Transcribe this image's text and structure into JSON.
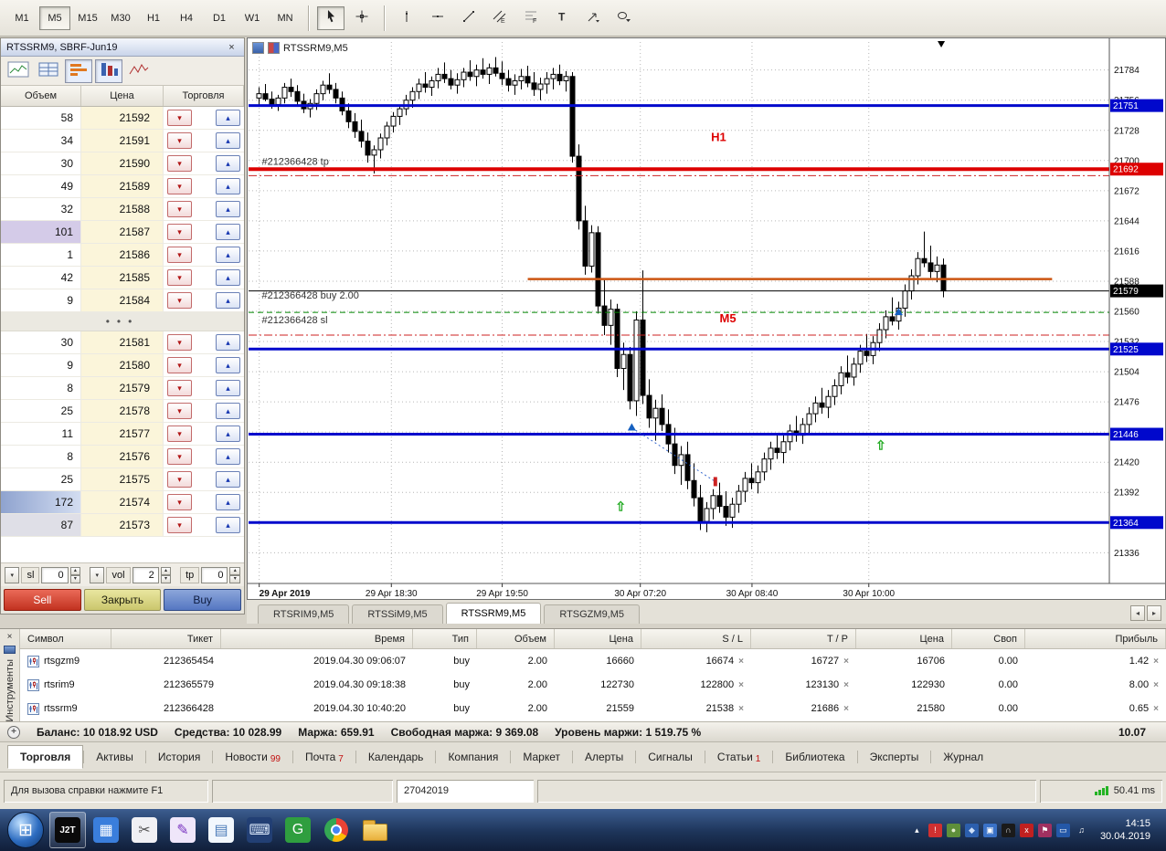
{
  "top_toolbar": {
    "timeframes": [
      "M1",
      "M5",
      "M15",
      "M30",
      "H1",
      "H4",
      "D1",
      "W1",
      "MN"
    ],
    "active_timeframe": "M5",
    "tools": [
      {
        "name": "cursor",
        "active": true
      },
      {
        "name": "crosshair"
      },
      {
        "name": "vertical-line"
      },
      {
        "name": "horizontal-line"
      },
      {
        "name": "trendline"
      },
      {
        "name": "equidistant-channel"
      },
      {
        "name": "fibonacci"
      },
      {
        "name": "text"
      },
      {
        "name": "arrows"
      },
      {
        "name": "objects-dropdown"
      }
    ]
  },
  "dom_panel": {
    "title": "RTSSRM9, SBRF-Jun19",
    "close_glyph": "×",
    "toolbar": [
      {
        "name": "new-chart-icon"
      },
      {
        "name": "market-depth-grid-icon"
      },
      {
        "name": "volume-profile-icon",
        "pressed": true
      },
      {
        "name": "dom-columns-icon",
        "pressed": true
      },
      {
        "name": "tick-chart-icon"
      }
    ],
    "columns": [
      "Объем",
      "Цена",
      "Торговля"
    ],
    "asks": [
      [
        58,
        21592
      ],
      [
        34,
        21591
      ],
      [
        30,
        21590
      ],
      [
        49,
        21589
      ],
      [
        32,
        21588
      ],
      [
        101,
        21587,
        "lav"
      ],
      [
        1,
        21586
      ],
      [
        42,
        21585
      ],
      [
        9,
        21584
      ]
    ],
    "dots": "•••",
    "bids": [
      [
        30,
        21581
      ],
      [
        9,
        21580
      ],
      [
        8,
        21579
      ],
      [
        25,
        21578
      ],
      [
        11,
        21577
      ],
      [
        8,
        21576
      ],
      [
        25,
        21575
      ],
      [
        172,
        21574,
        "blue"
      ],
      [
        87,
        21573,
        "gray"
      ]
    ],
    "controls": {
      "sl_label": "sl",
      "sl": "0",
      "vol_label": "vol",
      "vol": "2",
      "tp_label": "tp",
      "tp": "0"
    },
    "buttons": {
      "sell": "Sell",
      "close": "Закрыть",
      "buy": "Buy"
    }
  },
  "chart_data": {
    "type": "candlestick",
    "symbol_label": "RTSSRM9,M5",
    "ylim": [
      21310,
      21810
    ],
    "yticks": [
      21784,
      21756,
      21728,
      21700,
      21672,
      21644,
      21616,
      21588,
      21560,
      21532,
      21504,
      21476,
      21448,
      21420,
      21392,
      21364,
      21336
    ],
    "xticks": [
      {
        "text": "29 Apr 2019",
        "frac": 0.005,
        "bold": true,
        "anchor": "start"
      },
      {
        "text": "29 Apr 18:30",
        "frac": 0.16
      },
      {
        "text": "29 Apr 19:50",
        "frac": 0.29
      },
      {
        "text": "30 Apr 07:20",
        "frac": 0.452
      },
      {
        "text": "30 Apr 08:40",
        "frac": 0.583
      },
      {
        "text": "30 Apr 10:00",
        "frac": 0.72
      }
    ],
    "candles": [
      [
        21758,
        21768,
        21750,
        21762
      ],
      [
        21762,
        21771,
        21755,
        21757
      ],
      [
        21757,
        21764,
        21748,
        21752
      ],
      [
        21752,
        21761,
        21746,
        21758
      ],
      [
        21758,
        21772,
        21753,
        21768
      ],
      [
        21768,
        21776,
        21759,
        21764
      ],
      [
        21764,
        21770,
        21752,
        21755
      ],
      [
        21755,
        21762,
        21744,
        21748
      ],
      [
        21748,
        21757,
        21740,
        21753
      ],
      [
        21753,
        21766,
        21747,
        21762
      ],
      [
        21762,
        21774,
        21756,
        21770
      ],
      [
        21770,
        21781,
        21762,
        21766
      ],
      [
        21766,
        21772,
        21753,
        21758
      ],
      [
        21758,
        21764,
        21742,
        21746
      ],
      [
        21746,
        21753,
        21730,
        21736
      ],
      [
        21736,
        21744,
        21721,
        21727
      ],
      [
        21727,
        21738,
        21712,
        21718
      ],
      [
        21718,
        21726,
        21698,
        21705
      ],
      [
        21705,
        21714,
        21688,
        21710
      ],
      [
        21710,
        21725,
        21702,
        21721
      ],
      [
        21721,
        21736,
        21714,
        21732
      ],
      [
        21732,
        21745,
        21726,
        21741
      ],
      [
        21741,
        21752,
        21733,
        21748
      ],
      [
        21748,
        21761,
        21742,
        21756
      ],
      [
        21756,
        21768,
        21749,
        21764
      ],
      [
        21764,
        21776,
        21757,
        21771
      ],
      [
        21771,
        21782,
        21763,
        21768
      ],
      [
        21768,
        21778,
        21760,
        21774
      ],
      [
        21774,
        21786,
        21767,
        21780
      ],
      [
        21780,
        21791,
        21772,
        21776
      ],
      [
        21776,
        21784,
        21766,
        21770
      ],
      [
        21770,
        21781,
        21762,
        21775
      ],
      [
        21775,
        21786,
        21768,
        21782
      ],
      [
        21782,
        21793,
        21774,
        21778
      ],
      [
        21778,
        21789,
        21769,
        21784
      ],
      [
        21784,
        21795,
        21776,
        21780
      ],
      [
        21780,
        21790,
        21771,
        21786
      ],
      [
        21786,
        21796,
        21778,
        21781
      ],
      [
        21781,
        21792,
        21770,
        21776
      ],
      [
        21776,
        21784,
        21764,
        21770
      ],
      [
        21770,
        21780,
        21761,
        21774
      ],
      [
        21774,
        21785,
        21766,
        21778
      ],
      [
        21778,
        21788,
        21768,
        21772
      ],
      [
        21772,
        21782,
        21760,
        21766
      ],
      [
        21766,
        21777,
        21756,
        21771
      ],
      [
        21771,
        21782,
        21762,
        21776
      ],
      [
        21776,
        21786,
        21766,
        21780
      ],
      [
        21780,
        21789,
        21770,
        21774
      ],
      [
        21774,
        21783,
        21764,
        21778
      ],
      [
        21778,
        21782,
        21698,
        21704
      ],
      [
        21704,
        21715,
        21636,
        21644
      ],
      [
        21644,
        21658,
        21594,
        21602
      ],
      [
        21602,
        21640,
        21596,
        21633
      ],
      [
        21633,
        21639,
        21558,
        21565
      ],
      [
        21565,
        21589,
        21538,
        21547
      ],
      [
        21547,
        21571,
        21529,
        21562
      ],
      [
        21562,
        21567,
        21499,
        21507
      ],
      [
        21507,
        21531,
        21487,
        21520
      ],
      [
        21520,
        21527,
        21469,
        21477
      ],
      [
        21477,
        21560,
        21463,
        21552
      ],
      [
        21552,
        21598,
        21474,
        21482
      ],
      [
        21482,
        21497,
        21452,
        21461
      ],
      [
        21461,
        21478,
        21440,
        21470
      ],
      [
        21470,
        21483,
        21449,
        21455
      ],
      [
        21455,
        21469,
        21429,
        21437
      ],
      [
        21437,
        21452,
        21409,
        21417
      ],
      [
        21417,
        21435,
        21399,
        21427
      ],
      [
        21427,
        21439,
        21395,
        21403
      ],
      [
        21403,
        21419,
        21379,
        21387
      ],
      [
        21387,
        21399,
        21357,
        21365
      ],
      [
        21365,
        21383,
        21355,
        21377
      ],
      [
        21377,
        21395,
        21367,
        21389
      ],
      [
        21389,
        21401,
        21373,
        21379
      ],
      [
        21379,
        21393,
        21361,
        21369
      ],
      [
        21369,
        21387,
        21359,
        21381
      ],
      [
        21381,
        21399,
        21373,
        21393
      ],
      [
        21393,
        21411,
        21383,
        21405
      ],
      [
        21405,
        21419,
        21395,
        21401
      ],
      [
        21401,
        21417,
        21391,
        21411
      ],
      [
        21411,
        21429,
        21403,
        21423
      ],
      [
        21423,
        21439,
        21413,
        21433
      ],
      [
        21433,
        21447,
        21423,
        21429
      ],
      [
        21429,
        21445,
        21419,
        21439
      ],
      [
        21439,
        21455,
        21431,
        21449
      ],
      [
        21449,
        21463,
        21439,
        21445
      ],
      [
        21445,
        21461,
        21437,
        21455
      ],
      [
        21455,
        21471,
        21447,
        21465
      ],
      [
        21465,
        21481,
        21457,
        21475
      ],
      [
        21475,
        21489,
        21465,
        21471
      ],
      [
        21471,
        21487,
        21461,
        21481
      ],
      [
        21481,
        21497,
        21473,
        21491
      ],
      [
        21491,
        21509,
        21483,
        21503
      ],
      [
        21503,
        21519,
        21493,
        21499
      ],
      [
        21499,
        21517,
        21491,
        21511
      ],
      [
        21511,
        21529,
        21503,
        21523
      ],
      [
        21523,
        21539,
        21513,
        21519
      ],
      [
        21519,
        21537,
        21511,
        21531
      ],
      [
        21531,
        21549,
        21523,
        21543
      ],
      [
        21543,
        21561,
        21535,
        21555
      ],
      [
        21555,
        21573,
        21547,
        21551
      ],
      [
        21551,
        21569,
        21543,
        21563
      ],
      [
        21563,
        21585,
        21555,
        21579
      ],
      [
        21579,
        21599,
        21571,
        21593
      ],
      [
        21593,
        21615,
        21585,
        21609
      ],
      [
        21609,
        21634,
        21601,
        21605
      ],
      [
        21605,
        21621,
        21591,
        21597
      ],
      [
        21597,
        21611,
        21587,
        21603
      ],
      [
        21603,
        21609,
        21573,
        21579
      ]
    ],
    "hlines": [
      {
        "price": 21751,
        "color": "#0008cc",
        "width": 3,
        "tag": true
      },
      {
        "price": 21692,
        "color": "#dd0000",
        "width": 4,
        "tag": true
      },
      {
        "price": 21686,
        "color": "#c22",
        "width": 1,
        "style": "dashdot"
      },
      {
        "price": 21559,
        "color": "#008800",
        "width": 1,
        "style": "dash"
      },
      {
        "price": 21538,
        "color": "#c22",
        "width": 1,
        "style": "dashdot"
      },
      {
        "price": 21525,
        "color": "#0008cc",
        "width": 3,
        "tag": true
      },
      {
        "price": 21446,
        "color": "#0008cc",
        "width": 3,
        "tag": true
      },
      {
        "price": 21364,
        "color": "#0008cc",
        "width": 3,
        "tag": true
      },
      {
        "price": 21590,
        "color": "#cc5511",
        "width": 2.5,
        "x1": 0.32,
        "x2": 0.935
      },
      {
        "price": 21579,
        "color": "#000000",
        "width": 1,
        "tag": true
      }
    ],
    "annotations": [
      {
        "text": "#212366428 tp",
        "frac": 0.008,
        "price": 21696,
        "color": "#333333"
      },
      {
        "text": "#212366428 buy 2.00",
        "frac": 0.008,
        "price": 21572,
        "color": "#333333"
      },
      {
        "text": "#212366428 sl",
        "frac": 0.008,
        "price": 21549,
        "color": "#333333"
      },
      {
        "text": "H1",
        "frac": 0.535,
        "price": 21718,
        "color": "#dd0000",
        "size": 13,
        "bold": true
      },
      {
        "text": "M5",
        "frac": 0.545,
        "price": 21550,
        "color": "#dd0000",
        "size": 13,
        "bold": true
      }
    ],
    "markers": [
      {
        "type": "buy-arrow",
        "frac": 0.442,
        "price": 21452,
        "color": "#1560c0"
      },
      {
        "type": "buy-arrow",
        "frac": 0.755,
        "price": 21559,
        "color": "#1560c0"
      },
      {
        "type": "close-marker",
        "frac": 0.54,
        "price": 21402,
        "color": "#cc2222"
      },
      {
        "type": "up-arrow",
        "frac": 0.429,
        "price": 21379,
        "color": "#22aa22"
      },
      {
        "type": "up-arrow",
        "frac": 0.734,
        "price": 21436,
        "color": "#22aa22"
      }
    ],
    "connector": {
      "from": 0,
      "to": 2,
      "color": "#3366cc"
    },
    "shift_frac": 0.805
  },
  "chart_tabs": {
    "tabs": [
      "RTSRIM9,M5",
      "RTSSiM9,M5",
      "RTSSRM9,M5",
      "RTSGZM9,M5"
    ],
    "active_index": 2,
    "scroll_left": "◂",
    "scroll_right": "▸"
  },
  "positions": {
    "columns": [
      "Символ",
      "Тикет",
      "Время",
      "Тип",
      "Объем",
      "Цена",
      "S / L",
      "T / P",
      "Цена",
      "Своп",
      "Прибыль"
    ],
    "rows": [
      {
        "symbol": "rtsgzm9",
        "ticket": "212365454",
        "time": "2019.04.30 09:06:07",
        "type": "buy",
        "volume": "2.00",
        "price": "16660",
        "sl": "16674",
        "tp": "16727",
        "price_current": "16706",
        "swap": "0.00",
        "profit": "1.42"
      },
      {
        "symbol": "rtsrim9",
        "ticket": "212365579",
        "time": "2019.04.30 09:18:38",
        "type": "buy",
        "volume": "2.00",
        "price": "122730",
        "sl": "122800",
        "tp": "123130",
        "price_current": "122930",
        "swap": "0.00",
        "profit": "8.00"
      },
      {
        "symbol": "rtssrm9",
        "ticket": "212366428",
        "time": "2019.04.30 10:40:20",
        "type": "buy",
        "volume": "2.00",
        "price": "21559",
        "sl": "21538",
        "tp": "21686",
        "price_current": "21580",
        "swap": "0.00",
        "profit": "0.65"
      }
    ],
    "remove_glyph": "×"
  },
  "account_bar": {
    "segments": [
      "Баланс: 10 018.92 USD",
      "Средства: 10 028.99",
      "Маржа: 659.91",
      "Свободная маржа: 9 369.08",
      "Уровень маржи: 1 519.75 %"
    ],
    "profit": "10.07"
  },
  "toolbox": {
    "vertical_tab": "Инструменты",
    "close_glyph": "×",
    "tabs": [
      {
        "label": "Торговля",
        "active": true
      },
      {
        "label": "Активы"
      },
      {
        "label": "История"
      },
      {
        "label": "Новости",
        "badge": "99"
      },
      {
        "label": "Почта",
        "badge": "7"
      },
      {
        "label": "Календарь"
      },
      {
        "label": "Компания"
      },
      {
        "label": "Маркет"
      },
      {
        "label": "Алерты"
      },
      {
        "label": "Сигналы"
      },
      {
        "label": "Статьи",
        "badge": "1"
      },
      {
        "label": "Библиотека"
      },
      {
        "label": "Эксперты"
      },
      {
        "label": "Журнал"
      }
    ]
  },
  "status_bar": {
    "help": "Для вызова справки нажмите F1",
    "field": "27042019",
    "latency": "50.41 ms"
  },
  "taskbar": {
    "start_glyph": "⊞",
    "apps": [
      {
        "name": "j2t-app",
        "label": "J2T",
        "bg": "#0a0a0a",
        "fg": "#ffffff",
        "active": true
      },
      {
        "name": "image-viewer-app",
        "glyph": "▦",
        "bg": "#3a7edc",
        "fg": "#ffffff"
      },
      {
        "name": "snipping-tool-app",
        "glyph": "✂",
        "bg": "#f0f0f4",
        "fg": "#555555"
      },
      {
        "name": "pen-tool-app",
        "glyph": "✎",
        "bg": "#efe6fa",
        "fg": "#7a35c0"
      },
      {
        "name": "notepad-app",
        "glyph": "▤",
        "bg": "#f2f7fd",
        "fg": "#4a7ab8"
      },
      {
        "name": "keyboard-app",
        "glyph": "⌨",
        "bg": "#223f74",
        "fg": "#d7e5f8"
      },
      {
        "name": "greenshot-app",
        "glyph": "G",
        "bg": "#2f9e3f",
        "fg": "#ffffff"
      },
      {
        "name": "chrome-app",
        "kind": "chrome"
      },
      {
        "name": "file-explorer-app",
        "kind": "folder"
      }
    ],
    "tray": [
      {
        "name": "hidden-icons-icon",
        "glyph": "▴",
        "bg": "none",
        "fg": "#ffffff"
      },
      {
        "name": "alert-tray-icon",
        "glyph": "!",
        "bg": "#d03030",
        "fg": "#ffffff"
      },
      {
        "name": "green-tray-icon",
        "glyph": "●",
        "bg": "#5e8f3a",
        "fg": "#dfeccc"
      },
      {
        "name": "blue-tray-icon",
        "glyph": "◆",
        "bg": "#2c5fae",
        "fg": "#cfe0f8"
      },
      {
        "name": "sync-tray-icon",
        "glyph": "▣",
        "bg": "#3a72c8",
        "fg": "#ffffff"
      },
      {
        "name": "audio-tray-icon",
        "glyph": "∩",
        "bg": "#1a1a1a",
        "fg": "#e0e0e0"
      },
      {
        "name": "antivirus-tray-icon",
        "glyph": "x",
        "bg": "#c02020",
        "fg": "#ffffff"
      },
      {
        "name": "flag-tray-icon",
        "glyph": "⚑",
        "bg": "#a03060",
        "fg": "#ffffff"
      },
      {
        "name": "display-tray-icon",
        "glyph": "▭",
        "bg": "#2458a8",
        "fg": "#ffffff"
      },
      {
        "name": "volume-tray-icon",
        "glyph": "♫",
        "bg": "none",
        "fg": "#ffffff"
      }
    ],
    "clock_time": "14:15",
    "clock_date": "30.04.2019"
  }
}
